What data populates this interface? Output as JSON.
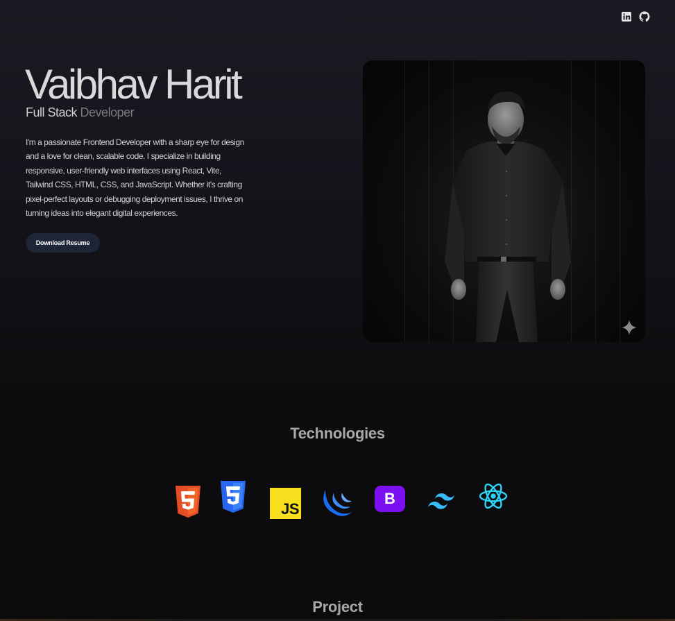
{
  "hero": {
    "name": "Vaibhav Harit",
    "role_main": "Full Stack",
    "role_dim": "Developer",
    "bio": "I'm a passionate Frontend Developer with a sharp eye for design and a love for clean, scalable code. I specialize in building responsive, user-friendly web interfaces using React, Vite, Tailwind CSS, HTML, CSS, and JavaScript. Whether it's crafting pixel-perfect layouts or debugging deployment issues, I thrive on turning ideas into elegant digital experiences.",
    "resume_button": "Download Resume"
  },
  "social": {
    "icons": [
      "linkedin-icon",
      "github-icon"
    ]
  },
  "technologies": {
    "title": "Technologies",
    "icons": [
      "html5-icon",
      "css3-icon",
      "javascript-icon",
      "jquery-icon",
      "bootstrap-icon",
      "tailwind-icon",
      "react-icon"
    ],
    "js_label": "JS",
    "bootstrap_label": "B"
  },
  "projects": {
    "title": "Project"
  },
  "colors": {
    "html5": "#e44d26",
    "css3": "#2965f1",
    "javascript": "#f7df1e",
    "jquery": "#1a6cf0",
    "bootstrap": "#7c10f2",
    "tailwind": "#38bdf8",
    "react": "#2bd4f5"
  }
}
